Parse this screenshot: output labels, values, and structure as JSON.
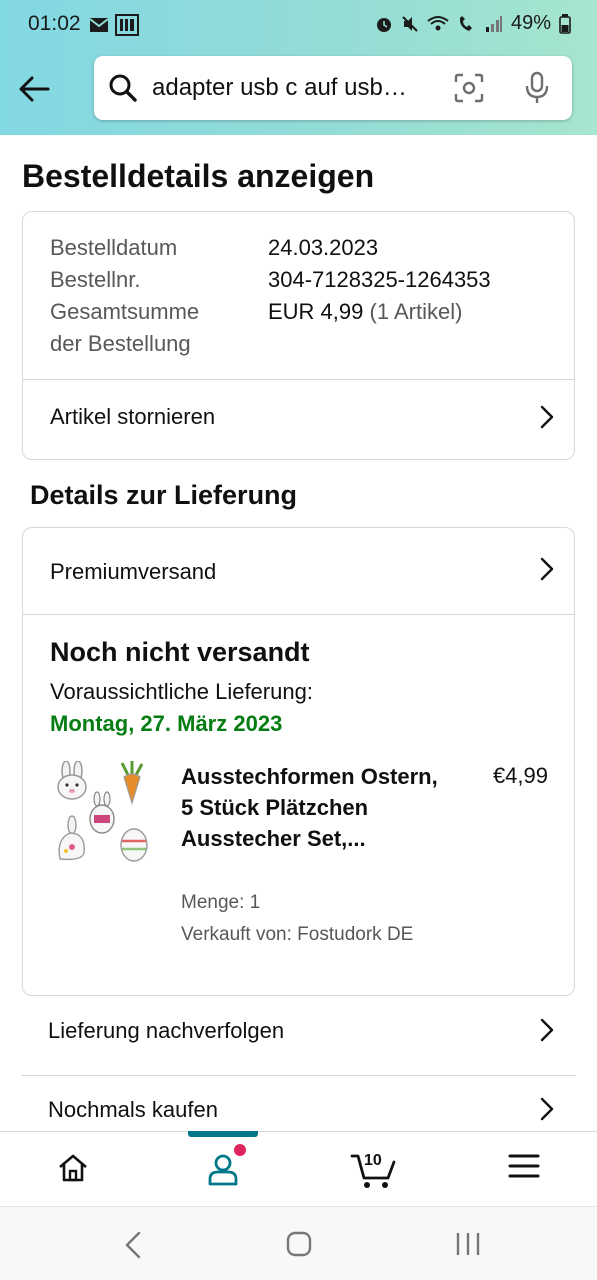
{
  "status_bar": {
    "time": "01:02",
    "battery": "49%"
  },
  "search": {
    "query": "adapter usb c auf usb…",
    "icons": [
      "back-arrow-icon",
      "search-icon",
      "camera-scan-icon",
      "microphone-icon"
    ]
  },
  "page": {
    "title": "Bestelldetails anzeigen"
  },
  "order": {
    "date_label": "Bestelldatum",
    "date_value": "24.03.2023",
    "number_label": "Bestellnr.",
    "number_value": "304-7128325-1264353",
    "total_label_line1": "Gesamtsumme",
    "total_label_line2": "der Bestellung",
    "total_value": "EUR 4,99",
    "total_items": "(1 Artikel)",
    "cancel_label": "Artikel stornieren"
  },
  "delivery": {
    "section_title": "Details zur Lieferung",
    "shipping_method": "Premiumversand",
    "status": "Noch nicht versandt",
    "expected_label": "Voraussichtliche Lieferung:",
    "expected_date": "Montag, 27. März 2023",
    "product": {
      "title": "Ausstechformen Ostern, 5 Stück Plätzchen Ausstecher Set,...",
      "price": "€4,99",
      "quantity": "Menge: 1",
      "seller": "Verkauft von: Fostudork DE"
    }
  },
  "actions": {
    "track": "Lieferung nachverfolgen",
    "buy_again": "Nochmals kaufen"
  },
  "bottom_nav": {
    "items": [
      "home-icon",
      "account-icon",
      "cart-icon",
      "menu-icon"
    ],
    "cart_count": "10",
    "active": "account-icon",
    "accent_color": "#00788a",
    "badge_color": "#e0245e"
  },
  "colors": {
    "delivery_green": "#067d12",
    "header_gradient_start": "#82d8e3",
    "header_gradient_end": "#a6e5cf"
  }
}
